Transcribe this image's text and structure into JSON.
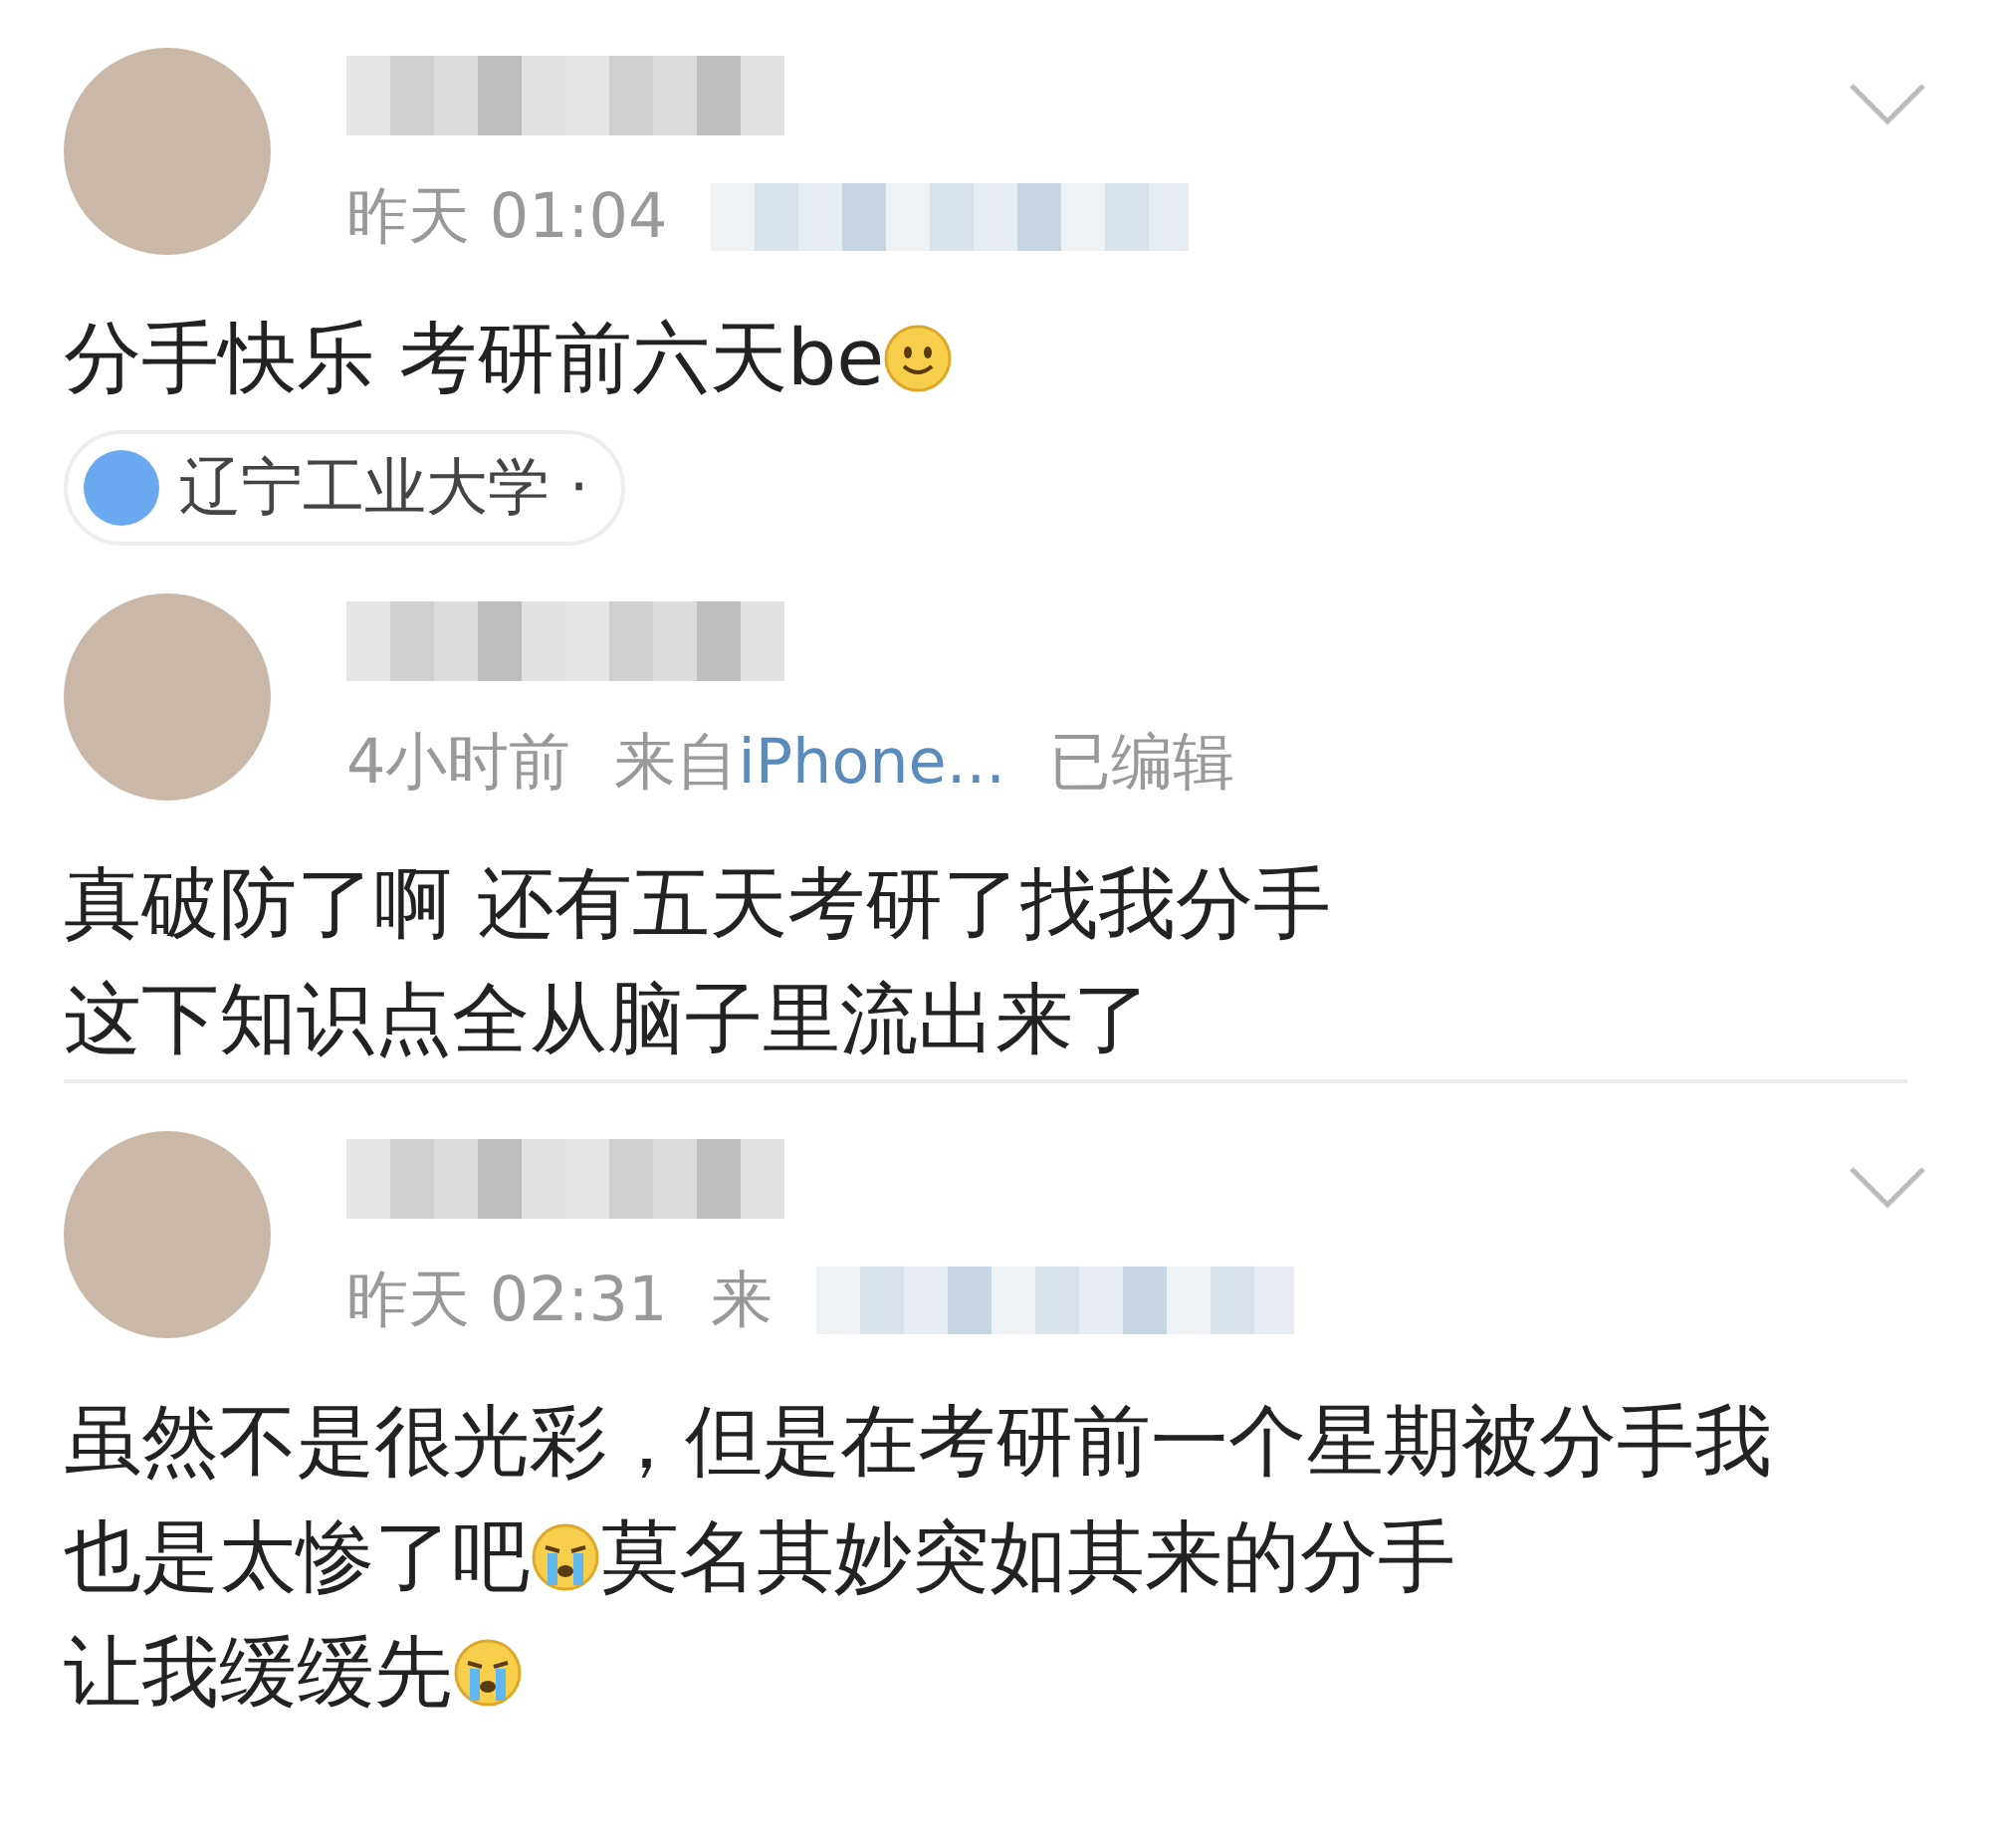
{
  "comments": [
    {
      "time": "昨天 01:04",
      "menu": true,
      "divider_before": false,
      "lines": [
        [
          {
            "kind": "text",
            "text": "分手快乐 考研前六天be"
          },
          {
            "kind": "smile-emoji"
          }
        ]
      ],
      "tag": {
        "label": "辽宁工业大学 ·"
      }
    },
    {
      "time": "4小时前",
      "source_prefix": "来自",
      "source": "iPhone...",
      "edited": "已编辑",
      "menu": false,
      "divider_before": false,
      "lines": [
        [
          {
            "kind": "text",
            "text": "真破防了啊 还有五天考研了找我分手"
          }
        ],
        [
          {
            "kind": "text",
            "text": "这下知识点全从脑子里流出来了"
          }
        ]
      ]
    },
    {
      "time": "昨天 02:31",
      "source_prefix": "来",
      "menu": true,
      "divider_before": true,
      "lines": [
        [
          {
            "kind": "text",
            "text": "虽然不是很光彩，但是在考研前一个星期被分手我"
          }
        ],
        [
          {
            "kind": "text",
            "text": "也是太惨了吧"
          },
          {
            "kind": "cry-emoji"
          },
          {
            "kind": "text",
            "text": "莫名其妙突如其来的分手"
          }
        ],
        [
          {
            "kind": "text",
            "text": "让我缓缓先"
          },
          {
            "kind": "cry-emoji"
          }
        ]
      ]
    }
  ]
}
